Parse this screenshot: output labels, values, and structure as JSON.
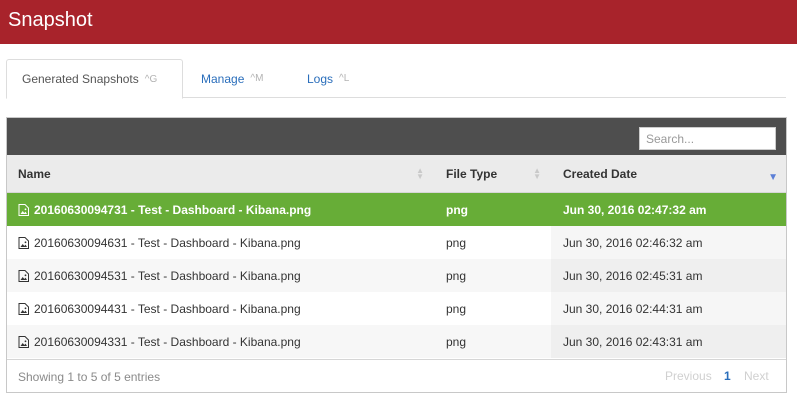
{
  "header": {
    "title": "Snapshot"
  },
  "tabs": [
    {
      "label": "Generated Snapshots",
      "shortcut": "^G"
    },
    {
      "label": "Manage",
      "shortcut": "^M"
    },
    {
      "label": "Logs",
      "shortcut": "^L"
    }
  ],
  "search": {
    "placeholder": "Search..."
  },
  "table": {
    "columns": [
      "Name",
      "File Type",
      "Created Date"
    ],
    "rows": [
      {
        "name": "20160630094731 - Test - Dashboard - Kibana.png",
        "type": "png",
        "date": "Jun 30, 2016 02:47:32 am"
      },
      {
        "name": "20160630094631 - Test - Dashboard - Kibana.png",
        "type": "png",
        "date": "Jun 30, 2016 02:46:32 am"
      },
      {
        "name": "20160630094531 - Test - Dashboard - Kibana.png",
        "type": "png",
        "date": "Jun 30, 2016 02:45:31 am"
      },
      {
        "name": "20160630094431 - Test - Dashboard - Kibana.png",
        "type": "png",
        "date": "Jun 30, 2016 02:44:31 am"
      },
      {
        "name": "20160630094331 - Test - Dashboard - Kibana.png",
        "type": "png",
        "date": "Jun 30, 2016 02:43:31 am"
      }
    ]
  },
  "footer": {
    "info": "Showing 1 to 5 of 5 entries",
    "previous": "Previous",
    "page": "1",
    "next": "Next"
  },
  "colors": {
    "brand": "#a8232b",
    "selected_row": "#67ad37",
    "link": "#2a6ebb"
  },
  "icons": {
    "file": "image-file-icon",
    "sort": "sort-both-icon",
    "sort_desc": "sort-desc-icon"
  }
}
